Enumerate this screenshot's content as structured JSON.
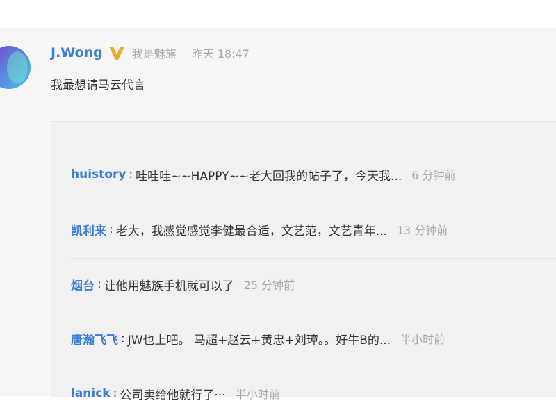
{
  "post": {
    "author": "J.Wong",
    "source": "我是魅族",
    "time": "昨天 18:47",
    "content": "我最想请马云代言",
    "verified_icon": "verified-v-icon",
    "verified_color": "#f5a623"
  },
  "replies": [
    {
      "user": "huistory",
      "text": "哇哇哇~~HAPPY~~老大回我的帖子了，今天我...",
      "time": "6 分钟前"
    },
    {
      "user": "凯利来",
      "text": "老大，我感觉感觉李健最合适，文艺范，文艺青年...",
      "time": "13 分钟前"
    },
    {
      "user": "烟台",
      "text": "让他用魅族手机就可以了",
      "time": "25 分钟前"
    },
    {
      "user": "唐瀚飞飞",
      "text": "JW也上吧。 马超+赵云+黄忠+刘璋。。好牛B的...",
      "time": "半小时前"
    },
    {
      "user": "lanick",
      "text": "公司卖给他就行了···",
      "time": "半小时前"
    }
  ],
  "colors": {
    "link": "#3b7dd8",
    "muted": "#a8a8a8",
    "text": "#333333"
  }
}
